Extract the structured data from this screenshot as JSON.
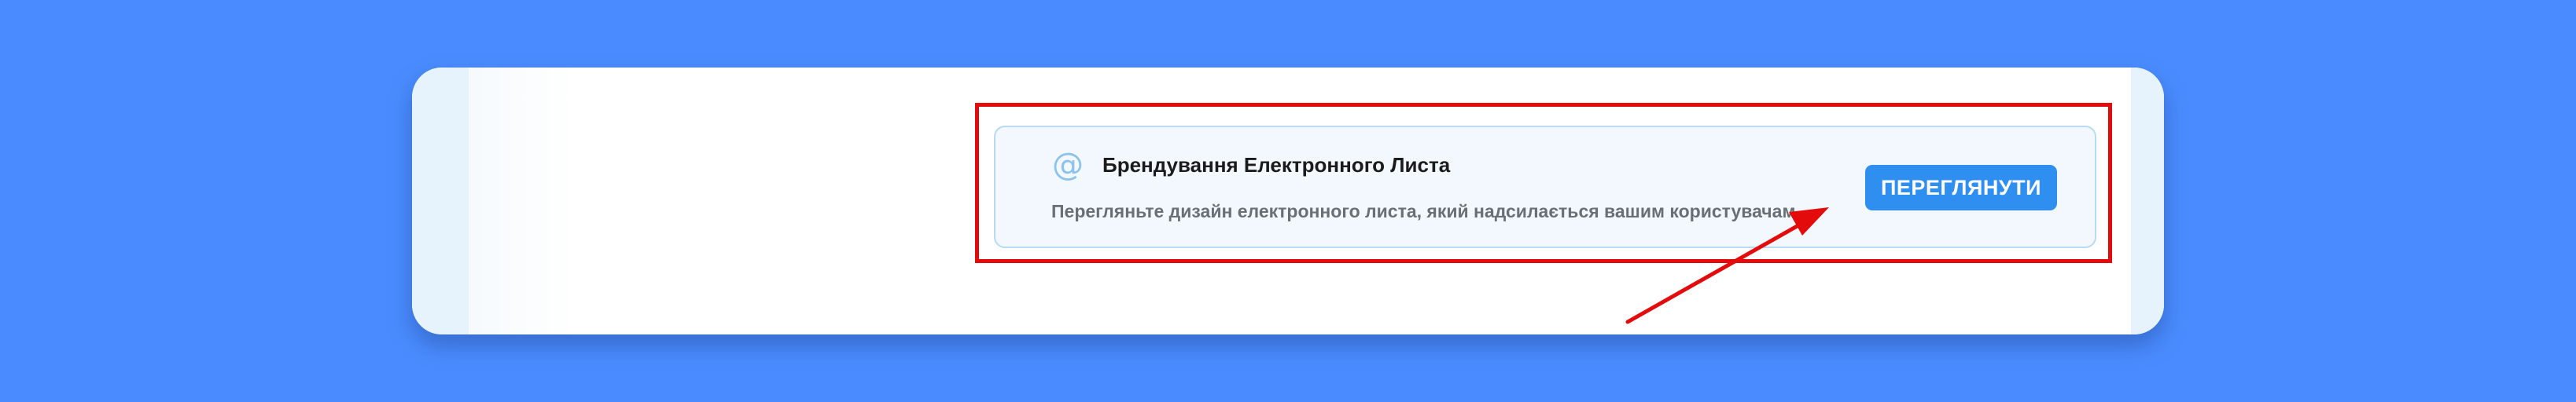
{
  "card": {
    "icon": "at-sign-icon",
    "icon_glyph": "@",
    "title": "Брендування Електронного Листа",
    "description": "Перегляньте дизайн електронного листа, який надсилається вашим користувачам.",
    "button_label": "ПЕРЕГЛЯНУТИ"
  },
  "colors": {
    "background": "#4a8cff",
    "highlight_border": "#e30b0b",
    "button": "#2f8ff0",
    "card_background": "#f2f8fd",
    "card_border": "#b8dbf3",
    "icon": "#8cc2ec"
  }
}
